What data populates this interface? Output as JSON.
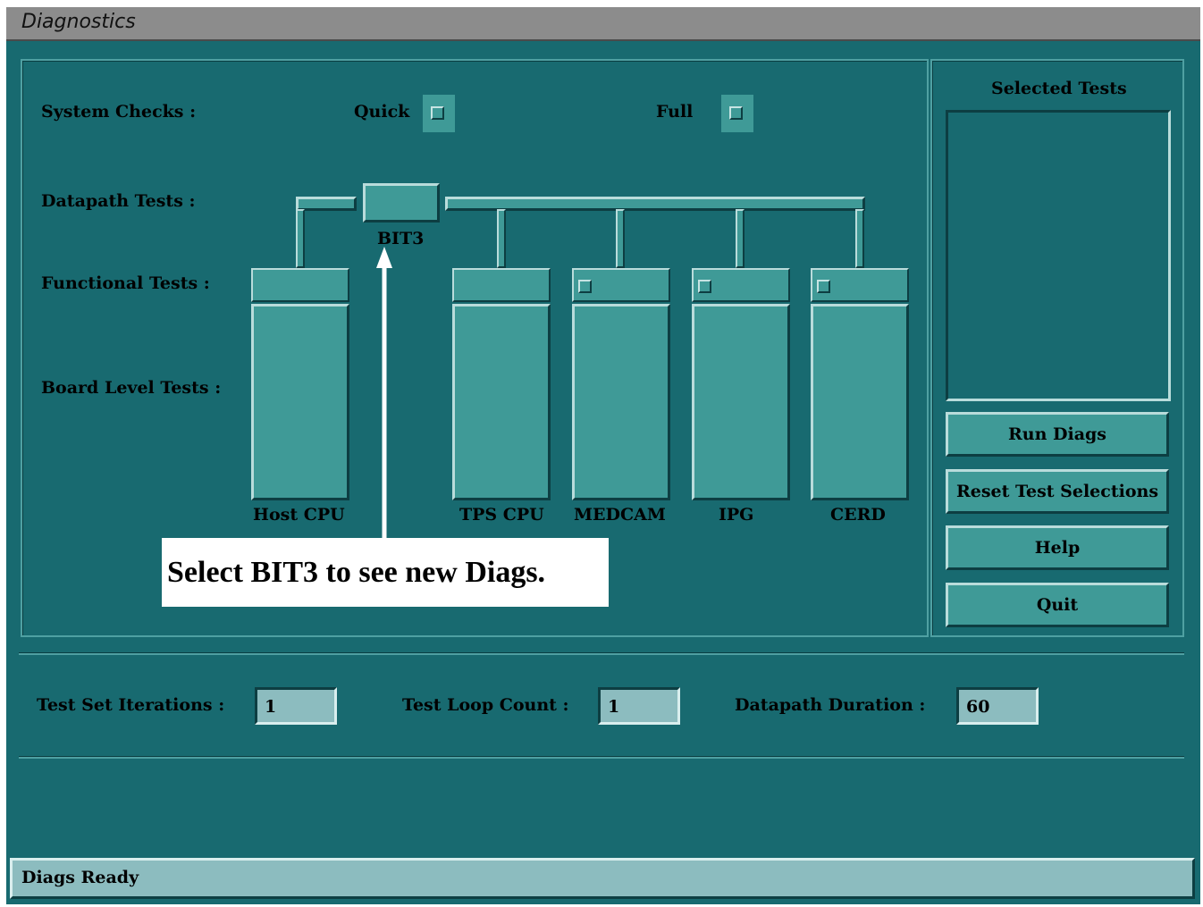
{
  "window": {
    "title": "Diagnostics"
  },
  "rows": {
    "system_checks": "System Checks :",
    "datapath_tests": "Datapath Tests :",
    "functional_tests": "Functional Tests :",
    "board_level_tests": "Board Level Tests :"
  },
  "system_checks": {
    "quick_label": "Quick",
    "full_label": "Full"
  },
  "datapath": {
    "bit3_label": "BIT3"
  },
  "boards": [
    {
      "label": "Host CPU",
      "has_checkbox": false
    },
    {
      "label": "TPS CPU",
      "has_checkbox": false
    },
    {
      "label": "MEDCAM",
      "has_checkbox": true
    },
    {
      "label": "IPG",
      "has_checkbox": true
    },
    {
      "label": "CERD",
      "has_checkbox": true
    }
  ],
  "selected_tests": {
    "title": "Selected Tests",
    "items": []
  },
  "buttons": {
    "run_diags": "Run Diags",
    "reset": "Reset Test Selections",
    "help": "Help",
    "quit": "Quit"
  },
  "settings": {
    "test_set_iterations": {
      "label": "Test Set Iterations :",
      "value": "1"
    },
    "test_loop_count": {
      "label": "Test Loop Count :",
      "value": "1"
    },
    "datapath_duration": {
      "label": "Datapath Duration :",
      "value": "60"
    }
  },
  "status": "Diags Ready",
  "annotation": {
    "callout_text": "Select BIT3 to see new Diags."
  },
  "colors": {
    "background": "#186a70",
    "widget": "#3f9a97",
    "field": "#8cbcbf",
    "titlebar": "#8c8c8c"
  }
}
